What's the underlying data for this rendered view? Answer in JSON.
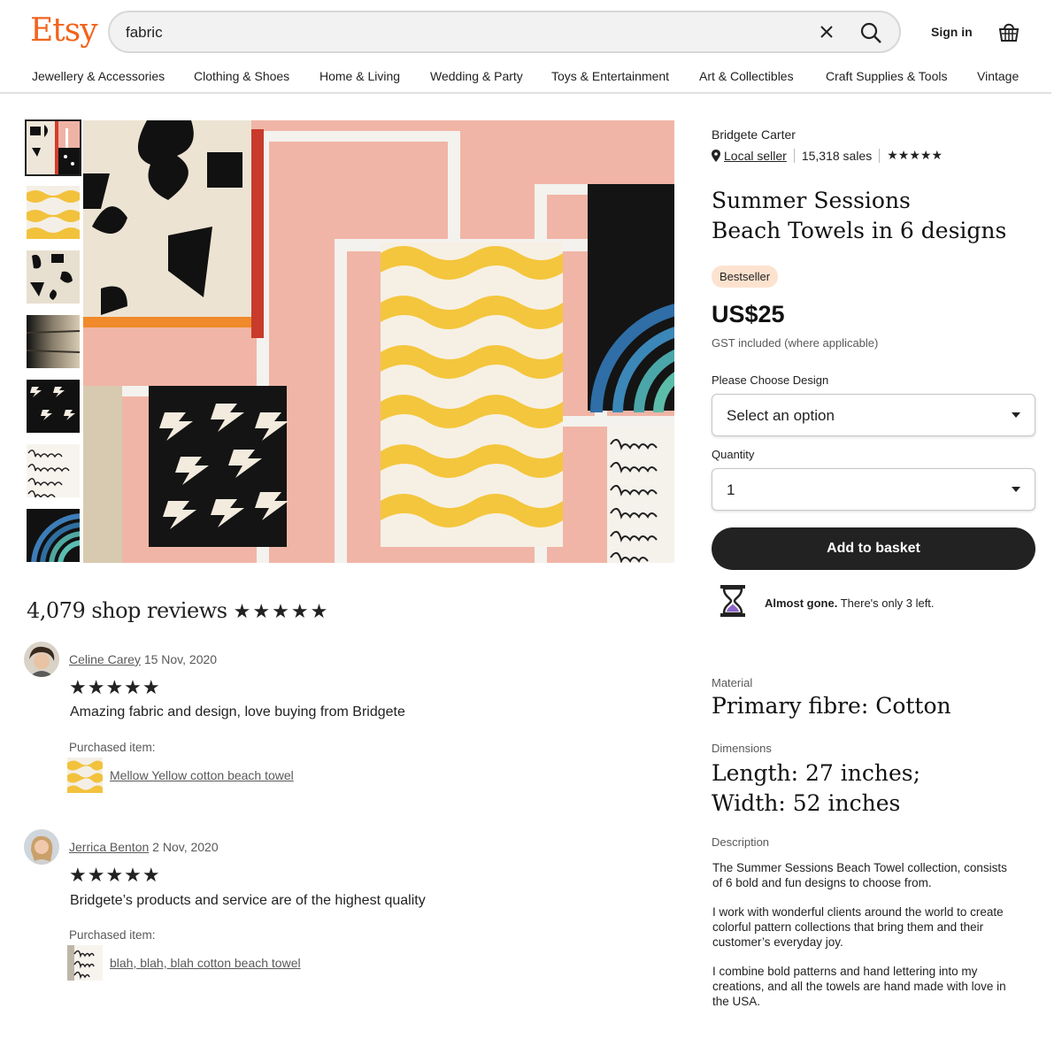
{
  "brand": {
    "logo": "Etsy",
    "accent_color": "#f1641e"
  },
  "search": {
    "value": "fabric",
    "clear_icon": "close-icon",
    "submit_icon": "search-icon"
  },
  "header": {
    "signin_label": "Sign in",
    "basket_icon": "basket-icon"
  },
  "nav": {
    "items": [
      "Jewellery & Accessories",
      "Clothing & Shoes",
      "Home & Living",
      "Wedding & Party",
      "Toys & Entertainment",
      "Art & Collectibles",
      "Craft Supplies & Tools",
      "Vintage"
    ]
  },
  "gallery": {
    "thumbnail_count": 7,
    "active_thumbnail": 1
  },
  "product": {
    "shop_name": "Bridgete Carter",
    "location_icon": "pin-icon",
    "local_seller": "Local seller",
    "sales": "15,318 sales",
    "shop_rating_stars": "★★★★★",
    "title_line1": "Summer Sessions",
    "title_line2": "Beach Towels in 6 designs",
    "badge": "Bestseller",
    "price": "US$25",
    "tax_note": "GST included (where applicable)",
    "design_label": "Please Choose Design",
    "design_value": "Select an option",
    "quantity_label": "Quantity",
    "quantity_value": "1",
    "add_button": "Add to basket",
    "stock_icon": "hourglass-icon",
    "stock_bold": "Almost gone.",
    "stock_text": " There's only 3 left."
  },
  "specs": {
    "material_label": "Material",
    "material_value": "Primary fibre: Cotton",
    "dimensions_label": "Dimensions",
    "dimensions_line1": "Length: 27 inches;",
    "dimensions_line2": "Width: 52 inches",
    "description_label": "Description",
    "description_paragraphs": [
      "The Summer Sessions Beach Towel collection, consists of 6 bold and fun designs to choose from.",
      "I work with wonderful clients around the world to create colorful pattern collections that bring them and their customer’s everyday joy.",
      "I combine bold patterns and hand lettering into my creations, and all the towels are hand made with love in the USA."
    ]
  },
  "reviews": {
    "title": "4,079 shop reviews",
    "title_stars": "★★★★★",
    "items": [
      {
        "name": "Celine Carey",
        "date": "15 Nov, 2020",
        "stars": "★★★★★",
        "text": "Amazing fabric and design, love buying from Bridgete",
        "purchased_label": "Purchased item:",
        "item": "Mellow Yellow cotton beach towel"
      },
      {
        "name": "Jerrica Benton",
        "date": "2 Nov, 2020",
        "stars": "★★★★★",
        "text": "Bridgete’s products and service are of the highest quality",
        "purchased_label": "Purchased item:",
        "item": "blah, blah, blah cotton beach towel"
      }
    ]
  }
}
